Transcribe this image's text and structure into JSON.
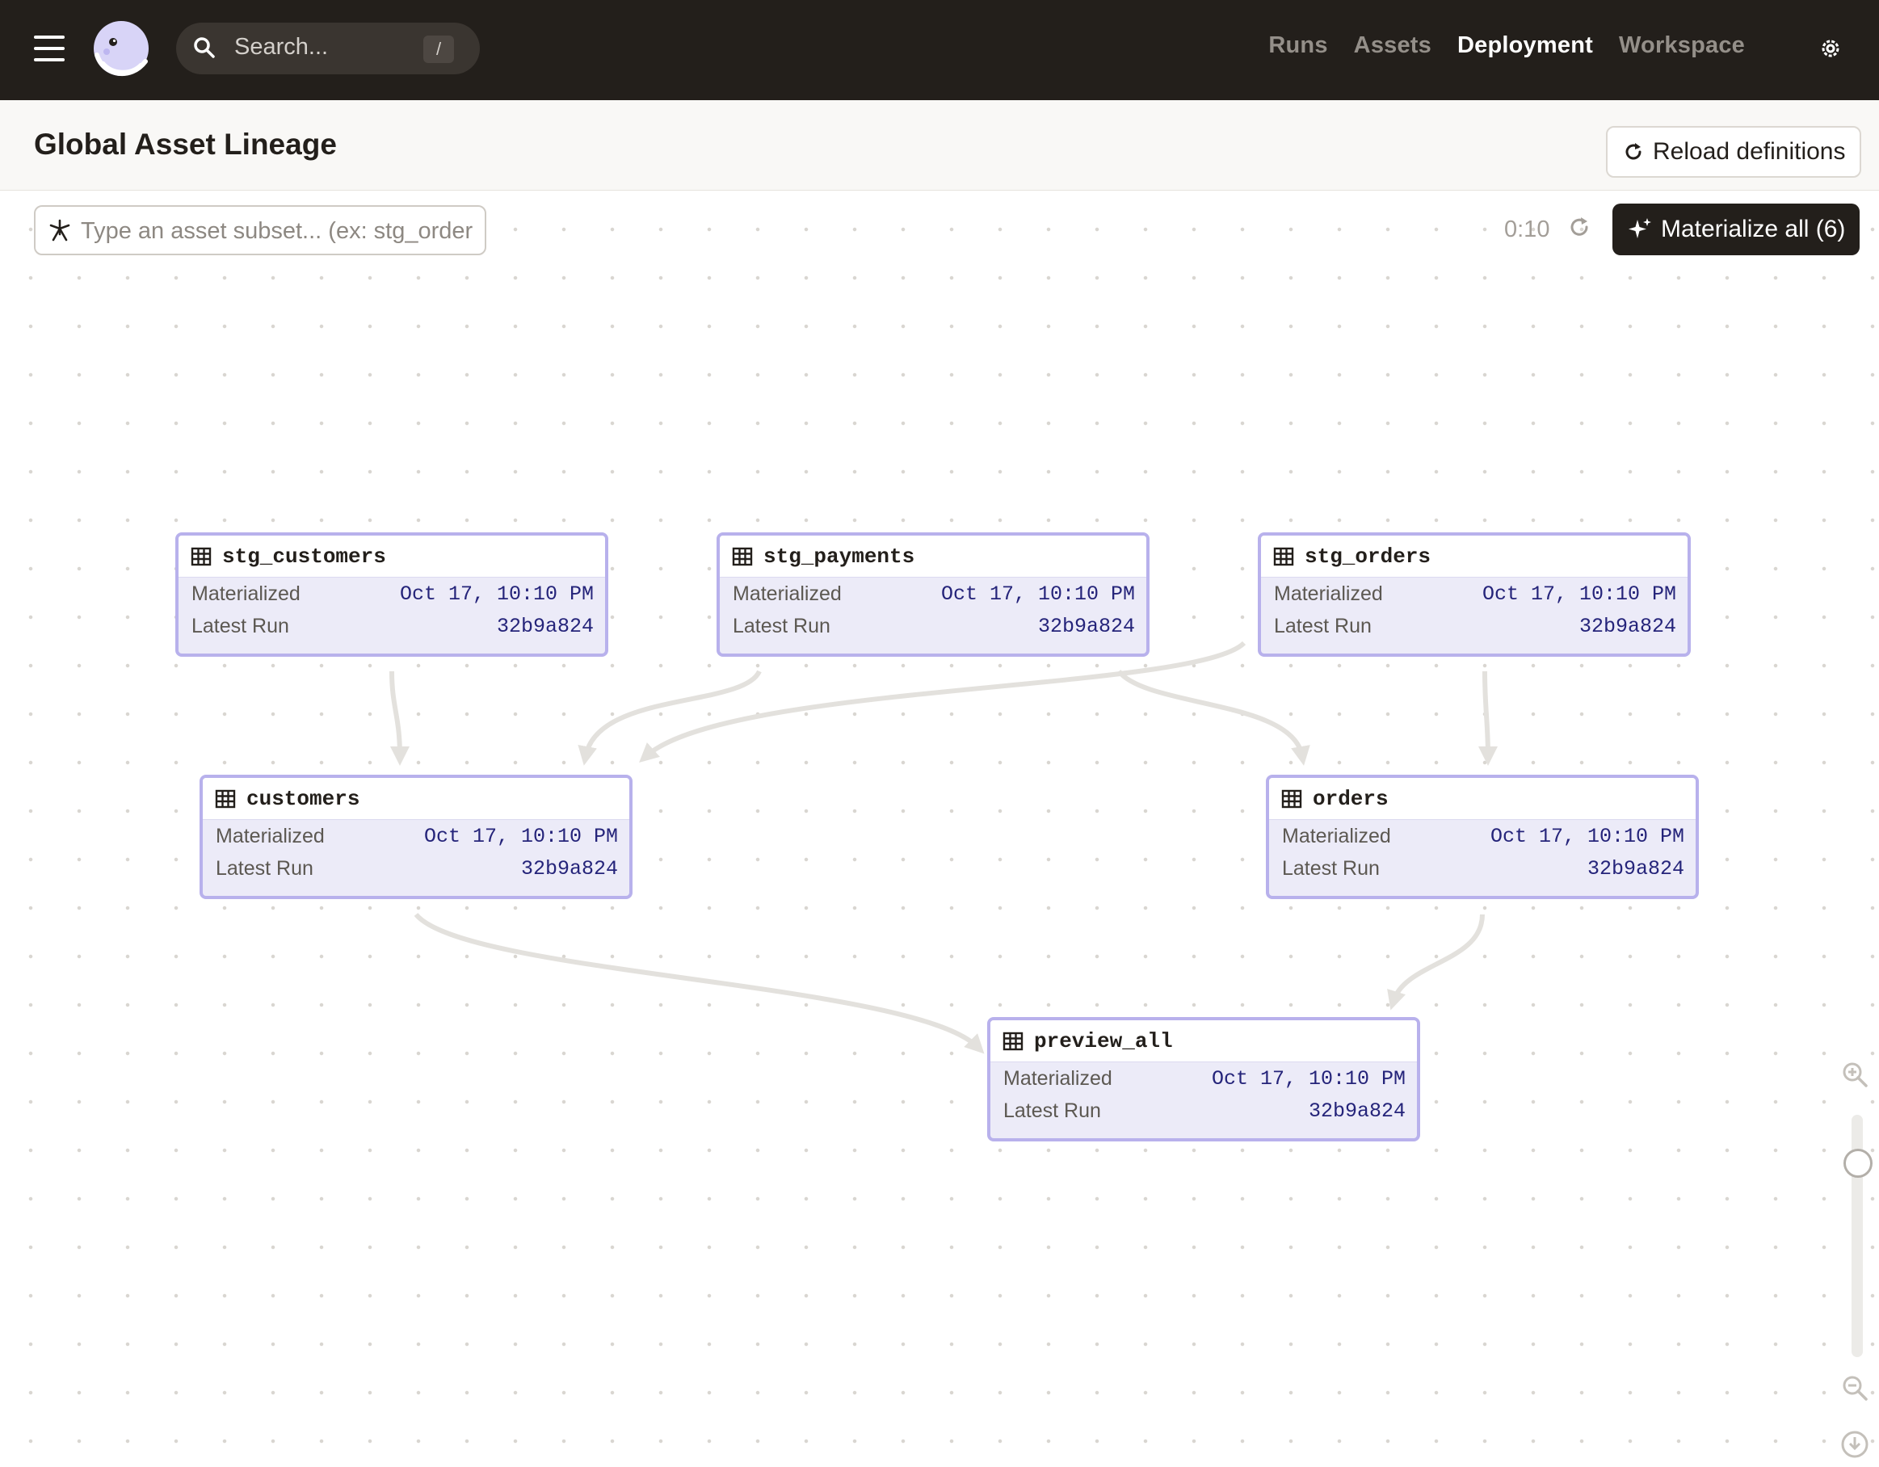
{
  "nav": {
    "menu_icon": "hamburger-icon",
    "logo_icon": "dagster-logo",
    "search": {
      "placeholder": "Search...",
      "shortcut": "/"
    },
    "links": [
      "Runs",
      "Assets",
      "Deployment",
      "Workspace"
    ],
    "active_link": "Deployment",
    "settings_icon": "gear-icon"
  },
  "header": {
    "title": "Global Asset Lineage",
    "reload_label": "Reload definitions"
  },
  "toolbar": {
    "filter_placeholder": "Type an asset subset... (ex: stg_order",
    "refresh_timer": "0:10",
    "materialize_label": "Materialize all (6)"
  },
  "graph": {
    "row_labels": {
      "materialized": "Materialized",
      "latest_run": "Latest Run"
    },
    "nodes": [
      {
        "id": "stg_customers",
        "name": "stg_customers",
        "materialized": "Oct 17, 10:10 PM",
        "latest_run": "32b9a824"
      },
      {
        "id": "stg_payments",
        "name": "stg_payments",
        "materialized": "Oct 17, 10:10 PM",
        "latest_run": "32b9a824"
      },
      {
        "id": "stg_orders",
        "name": "stg_orders",
        "materialized": "Oct 17, 10:10 PM",
        "latest_run": "32b9a824"
      },
      {
        "id": "customers",
        "name": "customers",
        "materialized": "Oct 17, 10:10 PM",
        "latest_run": "32b9a824"
      },
      {
        "id": "orders",
        "name": "orders",
        "materialized": "Oct 17, 10:10 PM",
        "latest_run": "32b9a824"
      },
      {
        "id": "preview_all",
        "name": "preview_all",
        "materialized": "Oct 17, 10:10 PM",
        "latest_run": "32b9a824"
      }
    ],
    "edges": [
      [
        "stg_customers",
        "customers"
      ],
      [
        "stg_payments",
        "customers"
      ],
      [
        "stg_orders",
        "customers"
      ],
      [
        "stg_payments",
        "orders"
      ],
      [
        "stg_orders",
        "orders"
      ],
      [
        "customers",
        "preview_all"
      ],
      [
        "orders",
        "preview_all"
      ]
    ]
  },
  "colors": {
    "topbar": "#231f1b",
    "node_border": "#b8b1ec",
    "node_fill": "#ecebf8",
    "edge": "#e3e1dd"
  }
}
